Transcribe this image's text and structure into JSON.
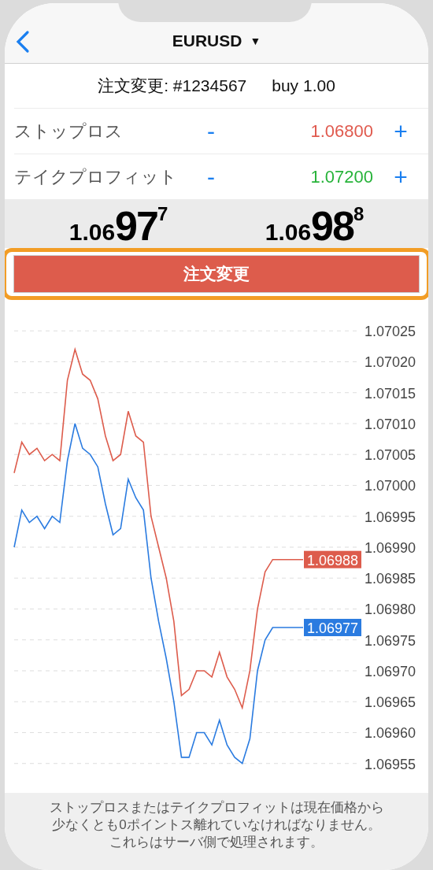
{
  "header": {
    "title": "EURUSD",
    "dropdown": "▼"
  },
  "order": {
    "label": "注文変更: #1234567",
    "trade": "buy 1.00"
  },
  "levels": [
    {
      "label": "ストップロス",
      "minus": "-",
      "value": "1.06800",
      "plus": "+",
      "color": "#e05a4e"
    },
    {
      "label": "テイクプロフィット",
      "minus": "-",
      "value": "1.07200",
      "plus": "+",
      "color": "#27b33a"
    }
  ],
  "prices": [
    {
      "head": "1.06",
      "big": "97",
      "tail": "7"
    },
    {
      "head": "1.06",
      "big": "98",
      "tail": "8"
    }
  ],
  "button": {
    "label": "注文変更"
  },
  "chart": {
    "ask_tag": "1.06988",
    "bid_tag": "1.06977",
    "chart_data": {
      "type": "line",
      "grid": true,
      "ylim": [
        1.06955,
        1.07025
      ],
      "yticks": [
        {
          "value": 1.07025,
          "label": "1.07025"
        },
        {
          "value": 1.0702,
          "label": "1.07020"
        },
        {
          "value": 1.07015,
          "label": "1.07015"
        },
        {
          "value": 1.0701,
          "label": "1.07010"
        },
        {
          "value": 1.07005,
          "label": "1.07005"
        },
        {
          "value": 1.07,
          "label": "1.07000"
        },
        {
          "value": 1.06995,
          "label": "1.06995"
        },
        {
          "value": 1.0699,
          "label": "1.06990"
        },
        {
          "value": 1.06985,
          "label": "1.06985"
        },
        {
          "value": 1.0698,
          "label": "1.06980"
        },
        {
          "value": 1.06975,
          "label": "1.06975"
        },
        {
          "value": 1.0697,
          "label": "1.06970"
        },
        {
          "value": 1.06965,
          "label": "1.06965"
        },
        {
          "value": 1.0696,
          "label": "1.06960"
        },
        {
          "value": 1.06955,
          "label": "1.06955"
        }
      ],
      "series": [
        {
          "color": "#dd5c4c",
          "values": [
            1.07002,
            1.07007,
            1.07005,
            1.07006,
            1.07004,
            1.07005,
            1.07004,
            1.07017,
            1.07022,
            1.07018,
            1.07017,
            1.07014,
            1.07008,
            1.07004,
            1.07005,
            1.07012,
            1.07008,
            1.07007,
            1.06995,
            1.0699,
            1.06985,
            1.06978,
            1.06966,
            1.06967,
            1.0697,
            1.0697,
            1.06969,
            1.06973,
            1.06969,
            1.06967,
            1.06964,
            1.0697,
            1.0698,
            1.06986,
            1.06988,
            1.06988,
            1.06988,
            1.06988,
            1.06988
          ]
        },
        {
          "color": "#2a7be0",
          "values": [
            1.0699,
            1.06996,
            1.06994,
            1.06995,
            1.06993,
            1.06995,
            1.06994,
            1.07004,
            1.0701,
            1.07006,
            1.07005,
            1.07003,
            1.06997,
            1.06992,
            1.06993,
            1.07001,
            1.06998,
            1.06996,
            1.06985,
            1.06978,
            1.06972,
            1.06965,
            1.06956,
            1.06956,
            1.0696,
            1.0696,
            1.06958,
            1.06962,
            1.06958,
            1.06956,
            1.06955,
            1.06959,
            1.0697,
            1.06975,
            1.06977,
            1.06977,
            1.06977,
            1.06977,
            1.06977
          ]
        }
      ]
    }
  },
  "note_lines": [
    "ストップロスまたはテイクプロフィットは現在価格から",
    "少なくとも0ポイントス離れていなければなりません。",
    "これらはサーバ側で処理されます。"
  ]
}
